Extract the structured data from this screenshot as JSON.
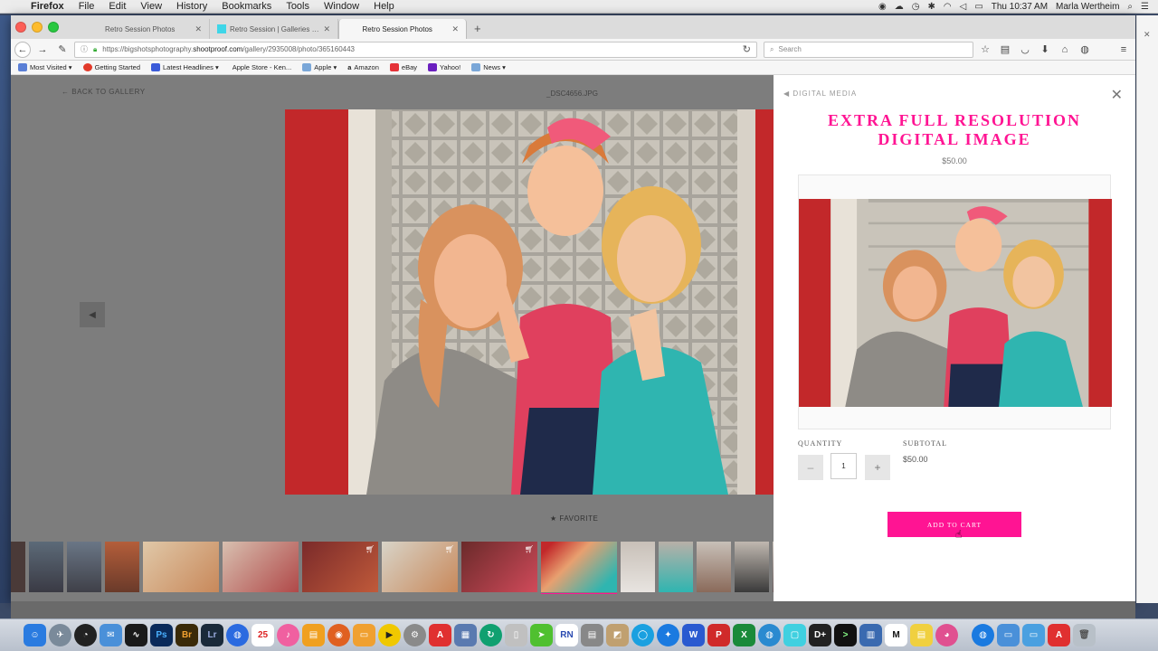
{
  "menubar": {
    "app": "Firefox",
    "items": [
      "File",
      "Edit",
      "View",
      "History",
      "Bookmarks",
      "Tools",
      "Window",
      "Help"
    ],
    "clock": "Thu 10:37 AM",
    "user": "Marla Wertheim"
  },
  "tabs": [
    {
      "title": "Retro Session Photos",
      "active": false
    },
    {
      "title": "Retro Session | Galleries | ...",
      "active": false
    },
    {
      "title": "Retro Session Photos",
      "active": true
    }
  ],
  "url": {
    "prefix": "https://bigshotsphotography.",
    "host": "shootproof.com",
    "path": "/gallery/2935008/photo/365160443"
  },
  "search": {
    "placeholder": "Search"
  },
  "bookmarks": [
    {
      "label": "Most Visited ▾",
      "color": "#5a7fd6"
    },
    {
      "label": "Getting Started",
      "color": "#e23a2a"
    },
    {
      "label": "Latest Headlines ▾",
      "color": "#3b5bd9"
    },
    {
      "label": "Apple Store - Ken...",
      "color": "#555555"
    },
    {
      "label": "Apple ▾",
      "color": "#7aa7d8"
    },
    {
      "label": "Amazon",
      "color": "#222222"
    },
    {
      "label": "eBay",
      "color": "#e53238"
    },
    {
      "label": "Yahoo!",
      "color": "#6a1fbf"
    },
    {
      "label": "News ▾",
      "color": "#7aa7d8"
    }
  ],
  "gallery": {
    "back": "BACK TO GALLERY",
    "filename": "_DSC4656.JPG",
    "favorite": "FAVORITE"
  },
  "panel": {
    "crumb": "DIGITAL MEDIA",
    "title_line1": "EXTRA FULL RESOLUTION",
    "title_line2": "DIGITAL IMAGE",
    "price": "$50.00",
    "quantity_label": "QUANTITY",
    "subtotal_label": "SUBTOTAL",
    "quantity": "1",
    "subtotal": "$50.00",
    "minus": "–",
    "plus": "+",
    "add_to_cart": "ADD TO CART"
  },
  "accent": "#ff1493"
}
